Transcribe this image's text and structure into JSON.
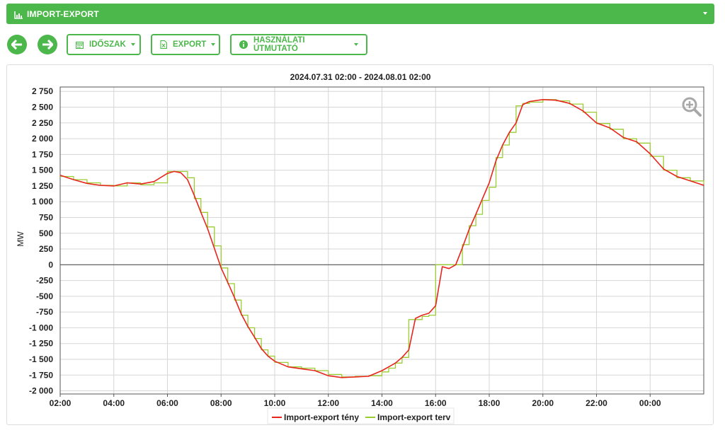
{
  "header": {
    "title": "IMPORT-EXPORT",
    "icon": "bar-chart-icon"
  },
  "toolbar": {
    "back_icon": "arrow-left-icon",
    "forward_icon": "arrow-right-icon",
    "period_label": "IDŐSZAK",
    "period_icon": "calendar-icon",
    "export_label": "EXPORT",
    "export_icon": "excel-file-icon",
    "guide_label": "HASZNÁLATI ÚTMUTATÓ",
    "guide_icon": "info-icon"
  },
  "colors": {
    "brand": "#4cb74a",
    "series_actual": "#e8251c",
    "series_plan": "#9acd32"
  },
  "chart_data": {
    "type": "line",
    "title": "2024.07.31 02:00 - 2024.08.01 02:00",
    "ylabel": "MW",
    "xlabel": "",
    "ylim": [
      -2050,
      2820
    ],
    "xlim": [
      2,
      26
    ],
    "x_ticks": [
      "02:00",
      "04:00",
      "06:00",
      "08:00",
      "10:00",
      "12:00",
      "14:00",
      "16:00",
      "18:00",
      "20:00",
      "22:00",
      "00:00"
    ],
    "y_ticks": [
      "2 750",
      "2 500",
      "2 250",
      "2 000",
      "1 750",
      "1 500",
      "1 250",
      "1 000",
      "750",
      "500",
      "250",
      "0",
      "-250",
      "-500",
      "-750",
      "-1 000",
      "-1 250",
      "-1 500",
      "-1 750",
      "-2 000"
    ],
    "grid": true,
    "legend_position": "bottom",
    "x": [
      2,
      2.5,
      3,
      3.5,
      4,
      4.5,
      5,
      5.5,
      6,
      6.25,
      6.5,
      6.75,
      7,
      7.25,
      7.5,
      7.75,
      8,
      8.25,
      8.5,
      8.75,
      9,
      9.25,
      9.5,
      9.75,
      10,
      10.5,
      11,
      11.5,
      12,
      12.5,
      13,
      13.5,
      14,
      14.25,
      14.5,
      14.75,
      15,
      15.25,
      15.5,
      15.75,
      16,
      16.25,
      16.5,
      16.75,
      17,
      17.25,
      17.5,
      17.75,
      18,
      18.25,
      18.5,
      18.75,
      19,
      19.25,
      19.5,
      20,
      20.5,
      21,
      21.5,
      22,
      22.5,
      23,
      23.5,
      24,
      24.5,
      25,
      25.5,
      26
    ],
    "series": [
      {
        "name": "Import-export tény",
        "color": "#e8251c",
        "values": [
          1420,
          1350,
          1290,
          1260,
          1250,
          1300,
          1280,
          1320,
          1450,
          1480,
          1460,
          1350,
          1100,
          830,
          570,
          260,
          -50,
          -280,
          -520,
          -780,
          -980,
          -1150,
          -1330,
          -1450,
          -1530,
          -1620,
          -1650,
          -1680,
          -1760,
          -1790,
          -1780,
          -1770,
          -1680,
          -1620,
          -1560,
          -1470,
          -1350,
          -850,
          -800,
          -770,
          -650,
          -30,
          -60,
          0,
          270,
          560,
          800,
          1050,
          1300,
          1650,
          1900,
          2100,
          2250,
          2540,
          2590,
          2620,
          2610,
          2560,
          2440,
          2250,
          2170,
          2020,
          1950,
          1760,
          1520,
          1400,
          1330,
          1260
        ]
      },
      {
        "name": "Import-export terv",
        "color": "#9acd32",
        "values": [
          1400,
          1350,
          1300,
          1260,
          1250,
          1300,
          1270,
          1300,
          1480,
          1480,
          1480,
          1380,
          1050,
          830,
          600,
          300,
          -50,
          -300,
          -560,
          -800,
          -1000,
          -1170,
          -1350,
          -1450,
          -1550,
          -1620,
          -1640,
          -1680,
          -1740,
          -1780,
          -1770,
          -1760,
          -1700,
          -1640,
          -1560,
          -1470,
          -870,
          -870,
          -820,
          -800,
          0,
          0,
          0,
          0,
          320,
          620,
          800,
          1020,
          1230,
          1700,
          1900,
          2100,
          2520,
          2560,
          2580,
          2620,
          2600,
          2550,
          2420,
          2240,
          2150,
          2000,
          1930,
          1720,
          1500,
          1380,
          1330,
          1280
        ]
      }
    ]
  }
}
